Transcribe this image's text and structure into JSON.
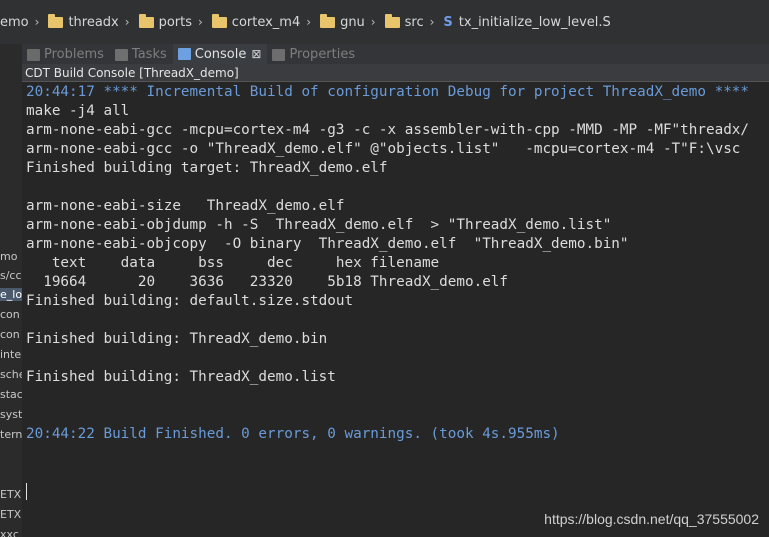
{
  "breadcrumb": {
    "items": [
      "emo",
      "threadx",
      "ports",
      "cortex_m4",
      "gnu",
      "src"
    ],
    "file_icon": "S",
    "file": "tx_initialize_low_level.S"
  },
  "left_panel": {
    "items": [
      "mo",
      "s/cc",
      "e_lov",
      "con",
      "con",
      "inte",
      "sche",
      "stac",
      "syst",
      "tern",
      "ETX",
      "ETX",
      "xxc"
    ]
  },
  "tabs": [
    {
      "label": "Problems",
      "icon": "problems-icon"
    },
    {
      "label": "Tasks",
      "icon": "tasks-icon"
    },
    {
      "label": "Console",
      "icon": "console-icon",
      "close": "⊠"
    },
    {
      "label": "Properties",
      "icon": "properties-icon"
    }
  ],
  "console": {
    "title": "CDT Build Console [ThreadX_demo]",
    "lines": [
      "20:44:17 **** Incremental Build of configuration Debug for project ThreadX_demo ****",
      "make -j4 all",
      "arm-none-eabi-gcc -mcpu=cortex-m4 -g3 -c -x assembler-with-cpp -MMD -MP -MF\"threadx/",
      "arm-none-eabi-gcc -o \"ThreadX_demo.elf\" @\"objects.list\"   -mcpu=cortex-m4 -T\"F:\\vsc",
      "Finished building target: ThreadX_demo.elf",
      "",
      "arm-none-eabi-size   ThreadX_demo.elf",
      "arm-none-eabi-objdump -h -S  ThreadX_demo.elf  > \"ThreadX_demo.list\"",
      "arm-none-eabi-objcopy  -O binary  ThreadX_demo.elf  \"ThreadX_demo.bin\"",
      "   text    data     bss     dec     hex filename",
      "  19664      20    3636   23320    5b18 ThreadX_demo.elf",
      "Finished building: default.size.stdout",
      "",
      "Finished building: ThreadX_demo.bin",
      "",
      "Finished building: ThreadX_demo.list",
      "",
      "",
      "20:44:22 Build Finished. 0 errors, 0 warnings. (took 4s.955ms)"
    ]
  },
  "watermark": "https://blog.csdn.net/qq_37555002"
}
